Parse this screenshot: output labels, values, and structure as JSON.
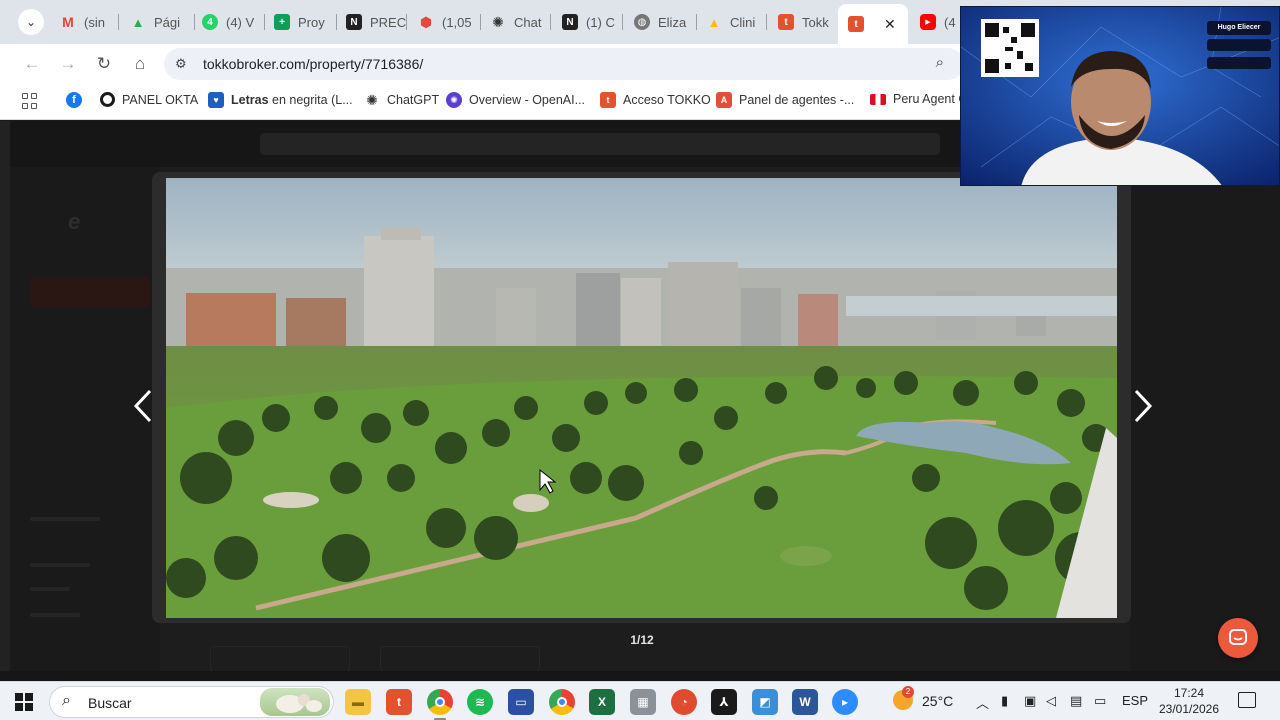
{
  "browser": {
    "tabs": [
      {
        "label": "(sin",
        "icon": "gmail-icon",
        "color": "#ea4335"
      },
      {
        "label": "Pági",
        "icon": "drive-icon",
        "color": "#34a853"
      },
      {
        "label": "(4) V",
        "icon": "whatsapp-icon",
        "color": "#25d366"
      },
      {
        "label": "Proy",
        "icon": "sheets-icon",
        "color": "#0f9d58"
      },
      {
        "label": "PREC",
        "icon": "notion-icon",
        "color": "#222222"
      },
      {
        "label": "(1,05",
        "icon": "cube-icon",
        "color": "#e8473b"
      },
      {
        "label": "Chat",
        "icon": "openai-icon",
        "color": "#333333"
      },
      {
        "label": "(1) C",
        "icon": "notion-icon",
        "color": "#222222"
      },
      {
        "label": "Eliza",
        "icon": "globe-icon",
        "color": "#666666"
      },
      {
        "label": "Clini",
        "icon": "drive-icon",
        "color": "#fbbc05"
      },
      {
        "label": "Tokk",
        "icon": "tokko-icon",
        "color": "#e2522f"
      },
      {
        "label": "",
        "icon": "tokko-icon",
        "color": "#e2522f",
        "active": true
      },
      {
        "label": "(4",
        "icon": "youtube-icon",
        "color": "#ff0000"
      }
    ],
    "url": "tokkobroker.com/property/7716386/",
    "bookmarks": [
      {
        "label": "PANEL OKTA",
        "icon": "okta-icon",
        "color": "#1a1a1a"
      },
      {
        "label_bold": "Letras",
        "label_rest": " en negrita (L...",
        "icon": "heart-icon",
        "color": "#1f5fbf"
      },
      {
        "label": "ChatGPT",
        "icon": "openai-icon",
        "color": "#333333"
      },
      {
        "label": "Overview - OpenAI...",
        "icon": "openai-icon",
        "color": "#5a3fd6"
      },
      {
        "label": "Acceso TOKKO",
        "icon": "tokko-icon",
        "color": "#e2522f"
      },
      {
        "label": "Panel de agentes -...",
        "icon": "a-icon",
        "color": "#e44d3a"
      },
      {
        "label": "Peru Agent C",
        "icon": "peru-flag-icon",
        "color": "#d91023"
      }
    ]
  },
  "viewer": {
    "counter": "1/12"
  },
  "webcam": {
    "name": "Hugo Eliecer"
  },
  "taskbar": {
    "search_placeholder": "Buscar",
    "weather_badge": "2",
    "temperature": "25°C",
    "language": "ESP",
    "time": "17:24",
    "date": "23/01/2026"
  }
}
